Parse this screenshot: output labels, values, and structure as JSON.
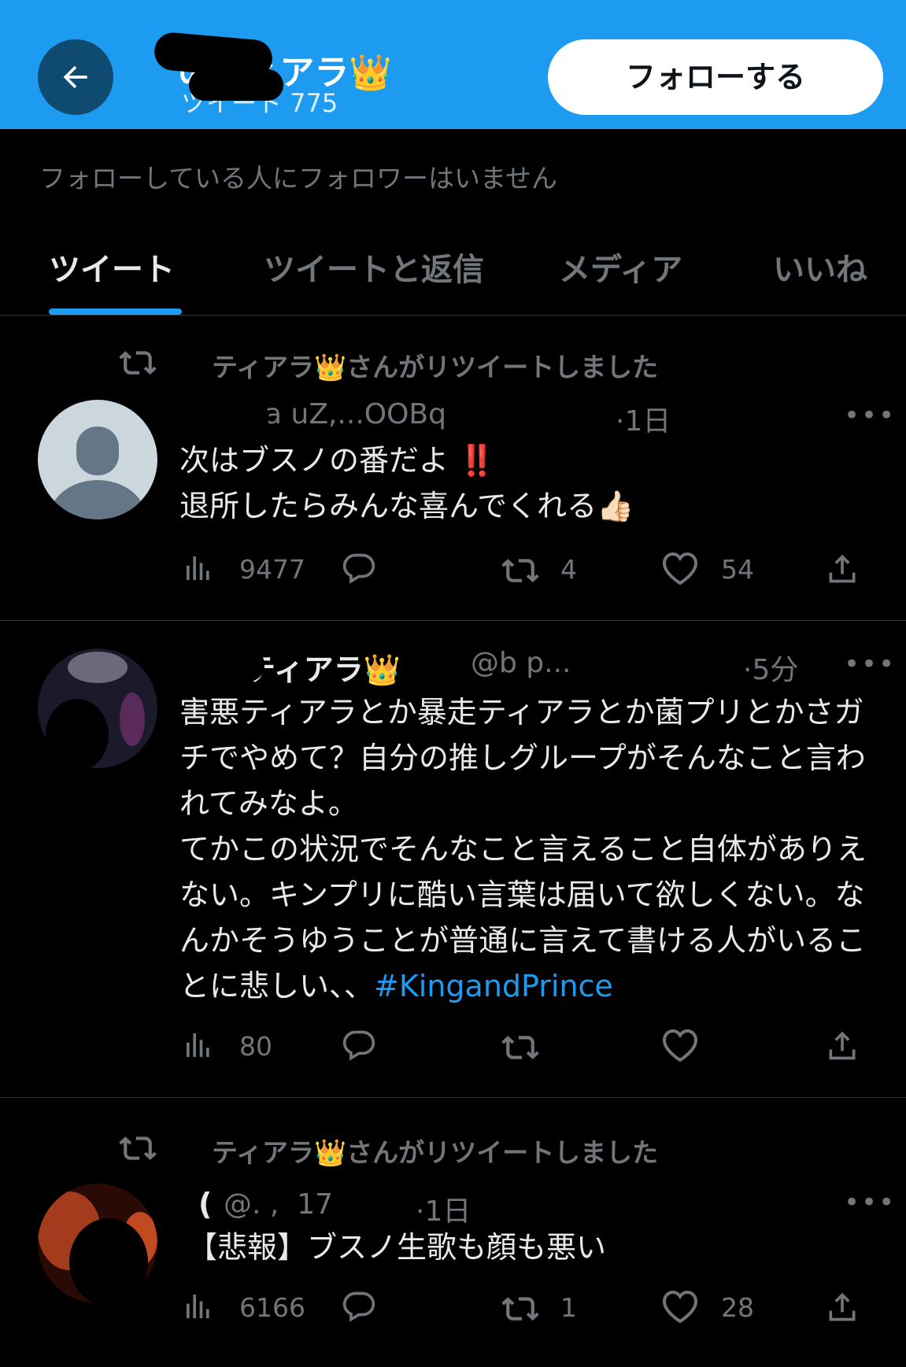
{
  "header": {
    "profile_name": "のティアラ👑",
    "tweet_count": "ツイート 775",
    "follow_button": "フォローする"
  },
  "follower_note": "フォローしている人にフォロワーはいません",
  "tabs": [
    "ツイート",
    "ツイートと返信",
    "メディア",
    "いいね"
  ],
  "tweets": [
    {
      "retweet_label": "のティアラ👑さんがリツイートしました",
      "handle": "@a      uZ,...OOBq",
      "time": "·1日",
      "text": "次はブスノの番だよ ‼️\n退所したらみんな喜んでくれる👍🏻",
      "views": "9477",
      "replies": "",
      "retweets": "4",
      "likes": "54"
    },
    {
      "name": "ティアラ👑",
      "handle": "@b      p...",
      "time": "·5分",
      "text": "害悪ティアラとか暴走ティアラとか菌プリとかさガチでやめて？自分の推しグループがそんなこと言われてみなよ。\nてかこの状況でそんなこと言えること自体がありえない。キンプリに酷い言葉は届いて欲しくない。なんかそうゆうことが普通に言えて書ける人がいることに悲しい、、",
      "hashtag": "#KingandPrince",
      "views": "80",
      "replies": "",
      "retweets": "",
      "likes": ""
    },
    {
      "retweet_label": "のティアラ👑さんがリツイートしました",
      "name": "(",
      "handle": "@.  ,  ‌ 17",
      "time": "·1日",
      "text": "【悲報】ブスノ生歌も顔も悪い",
      "views": "6166",
      "replies": "",
      "retweets": "1",
      "likes": "28"
    }
  ],
  "colors": {
    "accent": "#1d9bf0",
    "background": "#000000",
    "secondary_text": "#71767b"
  },
  "icons": [
    "back-arrow-icon",
    "retweet-icon",
    "views-icon",
    "reply-icon",
    "like-icon",
    "share-icon",
    "more-icon",
    "default-avatar-icon"
  ]
}
